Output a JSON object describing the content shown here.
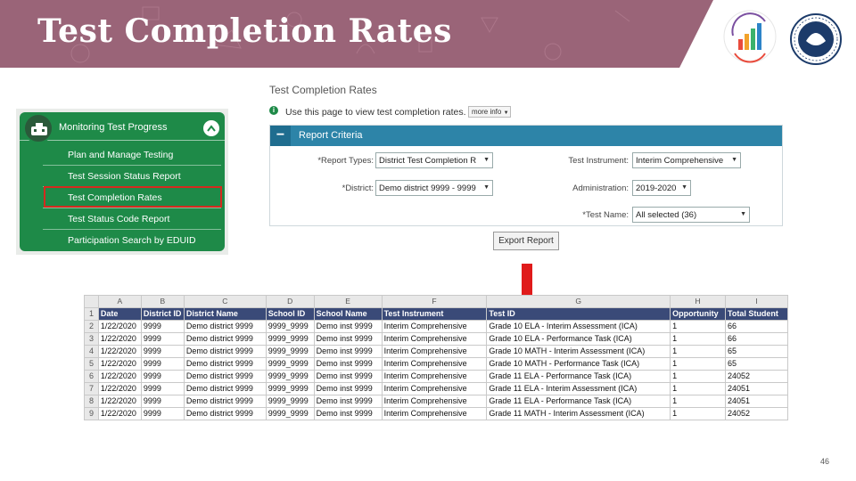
{
  "slide": {
    "title": "Test Completion Rates",
    "page_number": "46",
    "header_color": "#9a6478"
  },
  "menu": {
    "title": "Monitoring Test Progress",
    "collapse_icon": "chevron-up-icon",
    "items": [
      {
        "label": "Plan and Manage Testing"
      },
      {
        "label": "Test Session Status Report"
      },
      {
        "label": "Test Completion Rates",
        "highlighted": true
      },
      {
        "label": "Test Status Code Report"
      },
      {
        "label": "Participation Search by EDUID"
      }
    ]
  },
  "report": {
    "title": "Test Completion Rates",
    "info_text": "Use this page to view test completion rates.",
    "more_info_label": "more info",
    "criteria_label": "Report Criteria",
    "fields": {
      "report_types": {
        "label": "*Report Types:",
        "value": "District Test Completion R"
      },
      "test_instrument": {
        "label": "Test Instrument:",
        "value": "Interim Comprehensive"
      },
      "district": {
        "label": "*District:",
        "value": "Demo district 9999 - 9999"
      },
      "administration": {
        "label": "Administration:",
        "value": "2019-2020"
      },
      "test_name": {
        "label": "*Test Name:",
        "value": "All selected (36)"
      }
    },
    "export_label": "Export Report"
  },
  "spreadsheet": {
    "column_letters": [
      "A",
      "B",
      "C",
      "D",
      "E",
      "F",
      "G",
      "H",
      "I"
    ],
    "headers": [
      "Date",
      "District ID",
      "District Name",
      "School ID",
      "School Name",
      "Test Instrument",
      "Test ID",
      "Opportunity",
      "Total Student"
    ],
    "rows": [
      [
        "1/22/2020",
        "9999",
        "Demo district 9999",
        "9999_9999",
        "Demo inst 9999",
        "Interim Comprehensive",
        "Grade 10 ELA - Interim Assessment (ICA)",
        "1",
        "66"
      ],
      [
        "1/22/2020",
        "9999",
        "Demo district 9999",
        "9999_9999",
        "Demo inst 9999",
        "Interim Comprehensive",
        "Grade 10 ELA - Performance Task (ICA)",
        "1",
        "66"
      ],
      [
        "1/22/2020",
        "9999",
        "Demo district 9999",
        "9999_9999",
        "Demo inst 9999",
        "Interim Comprehensive",
        "Grade 10 MATH - Interim Assessment (ICA)",
        "1",
        "65"
      ],
      [
        "1/22/2020",
        "9999",
        "Demo district 9999",
        "9999_9999",
        "Demo inst 9999",
        "Interim Comprehensive",
        "Grade 10 MATH - Performance Task (ICA)",
        "1",
        "65"
      ],
      [
        "1/22/2020",
        "9999",
        "Demo district 9999",
        "9999_9999",
        "Demo inst 9999",
        "Interim Comprehensive",
        "Grade 11 ELA - Performance Task (ICA)",
        "1",
        "24052"
      ],
      [
        "1/22/2020",
        "9999",
        "Demo district 9999",
        "9999_9999",
        "Demo inst 9999",
        "Interim Comprehensive",
        "Grade 11 ELA - Interim Assessment (ICA)",
        "1",
        "24051"
      ],
      [
        "1/22/2020",
        "9999",
        "Demo district 9999",
        "9999_9999",
        "Demo inst 9999",
        "Interim Comprehensive",
        "Grade 11 ELA - Performance Task (ICA)",
        "1",
        "24051"
      ],
      [
        "1/22/2020",
        "9999",
        "Demo district 9999",
        "9999_9999",
        "Demo inst 9999",
        "Interim Comprehensive",
        "Grade 11 MATH - Interim Assessment (ICA)",
        "1",
        "24052"
      ]
    ]
  },
  "icons": {
    "arrow": "down-arrow-icon",
    "arrow_color": "#e01b1b",
    "logo_left": "assessment-logo-icon",
    "logo_right": "state-seal-icon"
  }
}
